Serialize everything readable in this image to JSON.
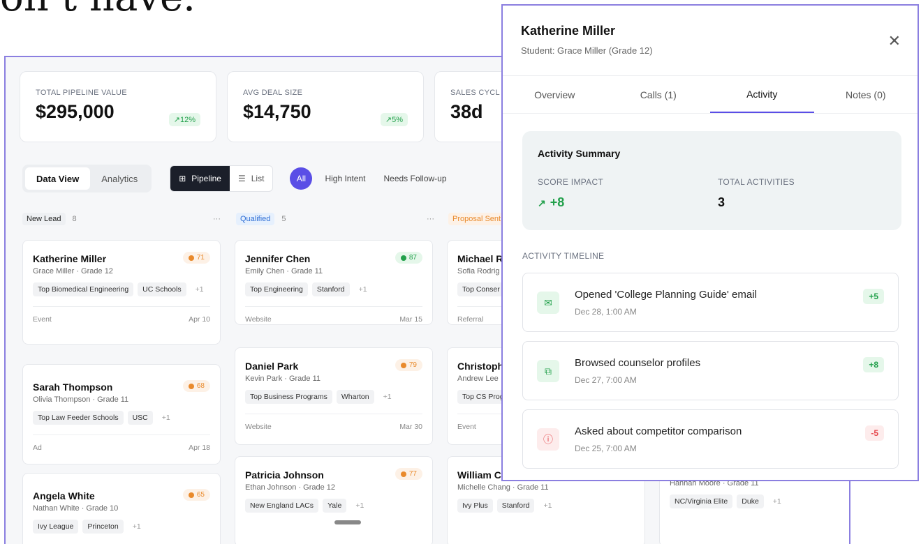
{
  "headline": "on t have.",
  "kpis": [
    {
      "label": "TOTAL PIPELINE VALUE",
      "value": "$295,000",
      "change": "↗12%"
    },
    {
      "label": "AVG DEAL SIZE",
      "value": "$14,750",
      "change": "↗5%"
    },
    {
      "label": "SALES CYCL",
      "value": "38d"
    }
  ],
  "toolbar": {
    "data_view": "Data View",
    "analytics": "Analytics",
    "pipeline": "Pipeline",
    "list": "List",
    "all": "All",
    "high_intent": "High Intent",
    "needs_followup": "Needs Follow-up"
  },
  "columns": [
    {
      "name": "New Lead",
      "count": "8",
      "more": "···"
    },
    {
      "name": "Qualified",
      "count": "5",
      "more": "···"
    },
    {
      "name": "Proposal Sent"
    }
  ],
  "cards": {
    "c1": {
      "name": "Katherine Miller",
      "sub": "Grace Miller · Grade 12",
      "score": "71",
      "tags": [
        "Top Biomedical Engineering",
        "UC Schools"
      ],
      "plus": "+1",
      "source": "Event",
      "date": "Apr 10"
    },
    "c2": {
      "name": "Sarah Thompson",
      "sub": "Olivia Thompson · Grade 11",
      "score": "68",
      "tags": [
        "Top Law Feeder Schools",
        "USC"
      ],
      "plus": "+1",
      "source": "Ad",
      "date": "Apr 18"
    },
    "c3": {
      "name": "Angela White",
      "sub": "Nathan White · Grade 10",
      "score": "65",
      "tags": [
        "Ivy League",
        "Princeton"
      ],
      "plus": "+1"
    },
    "c4": {
      "name": "Jennifer Chen",
      "sub": "Emily Chen · Grade 11",
      "score": "87",
      "tags": [
        "Top Engineering",
        "Stanford"
      ],
      "plus": "+1",
      "source": "Website",
      "date": "Mar 15"
    },
    "c5": {
      "name": "Daniel Park",
      "sub": "Kevin Park · Grade 11",
      "score": "79",
      "tags": [
        "Top Business Programs",
        "Wharton"
      ],
      "plus": "+1",
      "source": "Website",
      "date": "Mar 30"
    },
    "c6": {
      "name": "Patricia Johnson",
      "sub": "Ethan Johnson · Grade 12",
      "score": "77",
      "tags": [
        "New England LACs",
        "Yale"
      ],
      "plus": "+1"
    },
    "c7": {
      "name": "Michael Ro",
      "sub": "Sofia Rodrig",
      "tags": [
        "Top Conser"
      ],
      "source": "Referral"
    },
    "c8": {
      "name": "Christophe",
      "sub": "Andrew Lee",
      "tags": [
        "Top CS Prog"
      ],
      "source": "Event"
    },
    "c9": {
      "name": "William Ch",
      "sub": "Michelle Chang · Grade 11",
      "tags": [
        "Ivy Plus",
        "Stanford"
      ],
      "plus": "+1"
    },
    "c10": {
      "sub": "Hannah Moore · Grade 11",
      "tags": [
        "NC/Virginia Elite",
        "Duke"
      ],
      "plus": "+1"
    }
  },
  "panel": {
    "title": "Katherine Miller",
    "subtitle": "Student: Grace Miller (Grade 12)",
    "close": "✕",
    "tabs": [
      "Overview",
      "Calls (1)",
      "Activity",
      "Notes (0)"
    ],
    "summary_title": "Activity Summary",
    "score_impact_label": "SCORE IMPACT",
    "score_impact_value": "+8",
    "total_label": "TOTAL ACTIVITIES",
    "total_value": "3",
    "timeline_label": "ACTIVITY TIMELINE",
    "events": [
      {
        "title": "Opened 'College Planning Guide' email",
        "date": "Dec 28, 1:00 AM",
        "points": "+5",
        "icon": "mail-icon"
      },
      {
        "title": "Browsed counselor profiles",
        "date": "Dec 27, 7:00 AM",
        "points": "+8",
        "icon": "external-link-icon"
      },
      {
        "title": "Asked about competitor comparison",
        "date": "Dec 25, 7:00 AM",
        "points": "-5",
        "icon": "alert-icon"
      }
    ]
  },
  "colors": {
    "accent": "#5a4ee6",
    "frame": "#8b7fe0",
    "positive": "#22a04b",
    "negative": "#e5484d",
    "warm": "#e98a2c"
  }
}
